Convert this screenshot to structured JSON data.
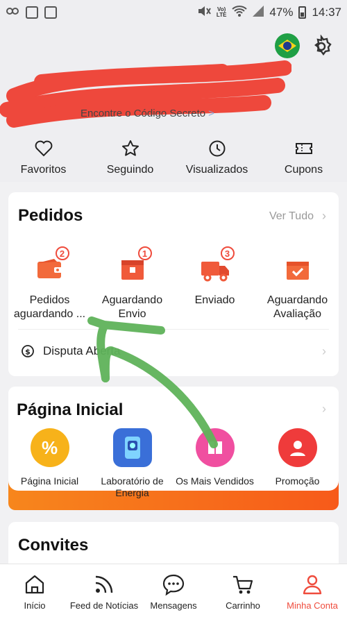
{
  "status_bar": {
    "battery": "47%",
    "time": "14:37",
    "network": "LTE"
  },
  "profile": {
    "secret_code_text": "Encontre o Código Secreto",
    "arrow": ">"
  },
  "quick_links": [
    {
      "label": "Favoritos",
      "icon": "heart-icon"
    },
    {
      "label": "Seguindo",
      "icon": "star-icon"
    },
    {
      "label": "Visualizados",
      "icon": "clock-icon"
    },
    {
      "label": "Cupons",
      "icon": "coupon-icon"
    }
  ],
  "orders": {
    "title": "Pedidos",
    "see_all": "Ver Tudo",
    "items": [
      {
        "label": "Pedidos\naguardando ...",
        "badge": "2",
        "icon": "wallet-icon"
      },
      {
        "label": "Aguardando\nEnvio",
        "badge": "1",
        "icon": "box-icon"
      },
      {
        "label": "Enviado",
        "badge": "3",
        "icon": "truck-icon"
      },
      {
        "label": "Aguardando\nAvaliação",
        "badge": "",
        "icon": "review-icon"
      }
    ],
    "dispute_label": "Disputa Aberta"
  },
  "home": {
    "title": "Página Inicial",
    "items": [
      {
        "label": "Página Inicial",
        "icon": "percent-icon",
        "color": "#f7b21a"
      },
      {
        "label": "Laboratório de Energia",
        "icon": "energy-lab-icon",
        "color": "#3a6fd8"
      },
      {
        "label": "Os Mais Vendidos",
        "icon": "best-sellers-icon",
        "color": "#f04fa0"
      },
      {
        "label": "Promoção",
        "icon": "promo-icon",
        "color": "#ef3b3b"
      }
    ]
  },
  "invites": {
    "title": "Convites"
  },
  "bottom_nav": [
    {
      "label": "Início",
      "icon": "home-icon"
    },
    {
      "label": "Feed de Notícias",
      "icon": "feed-icon"
    },
    {
      "label": "Mensagens",
      "icon": "chat-icon"
    },
    {
      "label": "Carrinho",
      "icon": "cart-icon"
    },
    {
      "label": "Minha Conta",
      "icon": "account-icon",
      "active": true
    }
  ],
  "colors": {
    "accent": "#ef4b3c",
    "annotation": "#5fb35a",
    "scribble": "#ee3a2d"
  }
}
